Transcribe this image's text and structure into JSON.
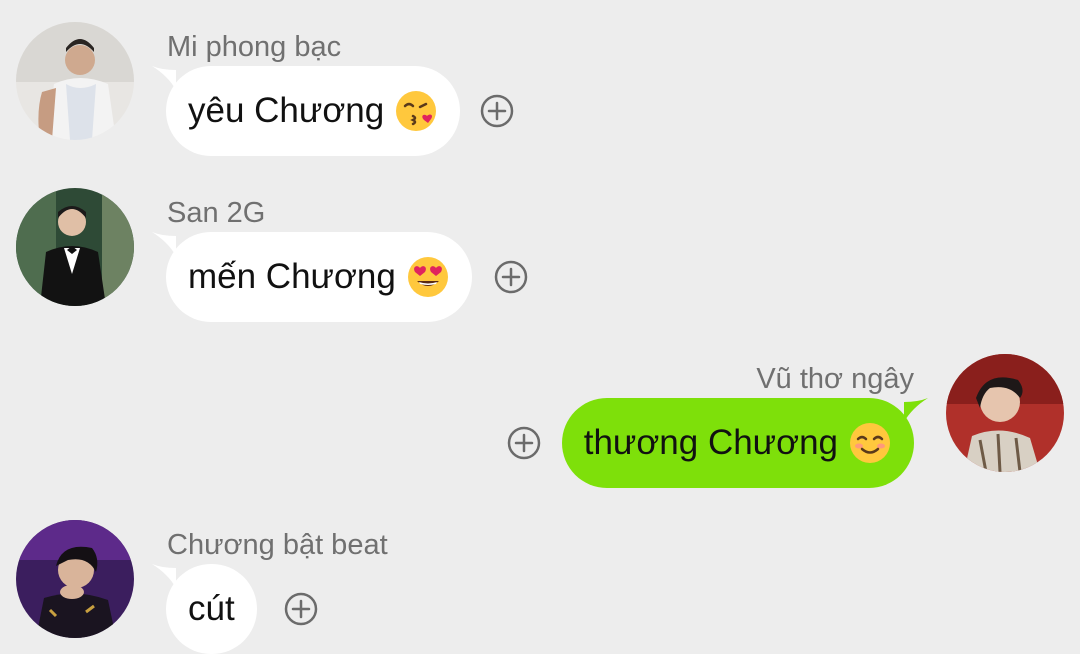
{
  "messages": [
    {
      "sender": "Mi phong bạc",
      "text": "yêu Chương",
      "emoji": "kissing-heart-emoji",
      "direction": "incoming"
    },
    {
      "sender": "San 2G",
      "text": "mến Chương",
      "emoji": "heart-eyes-emoji",
      "direction": "incoming"
    },
    {
      "sender": "Vũ thơ ngây",
      "text": "thương Chương",
      "emoji": "smiling-blush-emoji",
      "direction": "outgoing"
    },
    {
      "sender": "Chương bật beat",
      "text": "cút",
      "emoji": "",
      "direction": "incoming"
    }
  ],
  "colors": {
    "background": "#ededed",
    "incoming_bubble": "#ffffff",
    "outgoing_bubble": "#7ee00a",
    "sender_name": "#707070",
    "react_icon": "#6b6b6b"
  },
  "icons": {
    "react": "add-reaction-icon"
  }
}
